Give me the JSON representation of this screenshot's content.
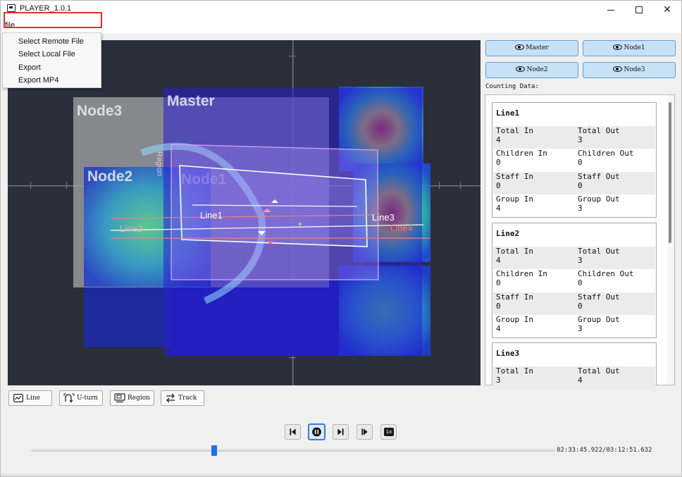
{
  "window": {
    "title": "PLAYER_1.0.1"
  },
  "menubar": {
    "file_label": "file"
  },
  "file_menu": {
    "items": [
      {
        "label": "Select Remote File"
      },
      {
        "label": "Select Local File",
        "highlighted": true
      },
      {
        "label": "Export"
      },
      {
        "label": "Export MP4"
      }
    ],
    "highlight_color": "#e0332b"
  },
  "video": {
    "nodes": [
      {
        "label": "Master"
      },
      {
        "label": "Node3"
      },
      {
        "label": "Node2"
      },
      {
        "label": "Node1"
      }
    ],
    "region_label": "Region",
    "lines": [
      {
        "label": "Line1"
      },
      {
        "label": "Line2"
      },
      {
        "label": "Line3"
      },
      {
        "label": "Line4"
      }
    ]
  },
  "view_buttons": [
    {
      "label": "Master",
      "icon": "eye-icon"
    },
    {
      "label": "Node1",
      "icon": "eye-icon"
    },
    {
      "label": "Node2",
      "icon": "eye-icon"
    },
    {
      "label": "Node3",
      "icon": "eye-icon"
    }
  ],
  "counting": {
    "label": "Counting Data:",
    "cards": [
      {
        "title": "Line1",
        "rows": [
          {
            "left_label": "Total In",
            "left_value": "4",
            "right_label": "Total Out",
            "right_value": "3"
          },
          {
            "left_label": "Children In",
            "left_value": "0",
            "right_label": "Children Out",
            "right_value": "0"
          },
          {
            "left_label": "Staff In",
            "left_value": "0",
            "right_label": "Staff Out",
            "right_value": "0"
          },
          {
            "left_label": "Group In",
            "left_value": "4",
            "right_label": "Group Out",
            "right_value": "3"
          }
        ]
      },
      {
        "title": "Line2",
        "rows": [
          {
            "left_label": "Total In",
            "left_value": "4",
            "right_label": "Total Out",
            "right_value": "3"
          },
          {
            "left_label": "Children In",
            "left_value": "0",
            "right_label": "Children Out",
            "right_value": "0"
          },
          {
            "left_label": "Staff In",
            "left_value": "0",
            "right_label": "Staff Out",
            "right_value": "0"
          },
          {
            "left_label": "Group In",
            "left_value": "4",
            "right_label": "Group Out",
            "right_value": "3"
          }
        ]
      },
      {
        "title": "Line3",
        "rows": [
          {
            "left_label": "Total In",
            "left_value": "3",
            "right_label": "Total Out",
            "right_value": "4"
          }
        ]
      }
    ]
  },
  "toolbar": [
    {
      "label": "Line",
      "icon": "line-chart-icon"
    },
    {
      "label": "U-turn",
      "icon": "u-turn-icon"
    },
    {
      "label": "Region",
      "icon": "region-icon"
    },
    {
      "label": "Track",
      "icon": "track-icon"
    }
  ],
  "playback": {
    "buttons": [
      {
        "name": "step-back-button",
        "icon": "step-back-icon"
      },
      {
        "name": "pause-button",
        "icon": "pause-icon",
        "active": true
      },
      {
        "name": "next-frame-button",
        "icon": "next-frame-icon"
      },
      {
        "name": "step-forward-button",
        "icon": "step-forward-icon"
      },
      {
        "name": "speed-button",
        "icon": "speed-icon",
        "label": "1x"
      }
    ],
    "progress_fraction": 0.35,
    "time": "02:33:45.922/03:12:51.632"
  }
}
